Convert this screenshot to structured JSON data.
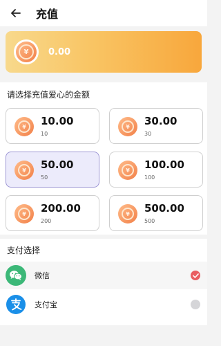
{
  "header": {
    "title": "充值",
    "back_icon": "arrow-left-icon"
  },
  "balance": {
    "amount": "0.00",
    "coin_symbol": "¥"
  },
  "amounts": {
    "title": "请选择充值爱心的金额",
    "options": [
      {
        "amount": "10.00",
        "sub": "10",
        "selected": false
      },
      {
        "amount": "30.00",
        "sub": "30",
        "selected": false
      },
      {
        "amount": "50.00",
        "sub": "50",
        "selected": true
      },
      {
        "amount": "100.00",
        "sub": "100",
        "selected": false
      },
      {
        "amount": "200.00",
        "sub": "200",
        "selected": false
      },
      {
        "amount": "500.00",
        "sub": "500",
        "selected": false
      }
    ]
  },
  "payment": {
    "title": "支付选择",
    "methods": [
      {
        "label": "微信",
        "icon": "wechat-icon",
        "selected": true
      },
      {
        "label": "支付宝",
        "icon": "alipay-icon",
        "selected": false
      }
    ]
  },
  "colors": {
    "selected_bg": "#ecebfb",
    "selected_border": "#9c95d4",
    "check_on": "#e95d61",
    "wechat_green": "#3cb878",
    "alipay_blue": "#1a8fe8"
  }
}
